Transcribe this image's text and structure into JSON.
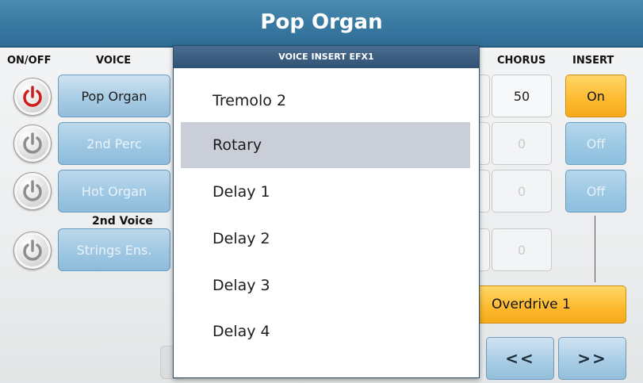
{
  "title": "Pop Organ",
  "headers": {
    "onoff": "ON/OFF",
    "voice": "VOICE",
    "chorus": "CHORUS",
    "insert": "INSERT"
  },
  "second_voice_label": "2nd Voice",
  "voices": [
    {
      "label": "Pop Organ",
      "power": "on"
    },
    {
      "label": "2nd Perc",
      "power": "off"
    },
    {
      "label": "Hot Organ",
      "power": "off"
    },
    {
      "label": "Strings Ens.",
      "power": "off"
    }
  ],
  "chorus_values": [
    "50",
    "0",
    "0",
    "0"
  ],
  "insert_buttons": [
    "On",
    "Off",
    "Off"
  ],
  "insert_effect": "Overdrive 1",
  "nav": {
    "prev": "<<",
    "next": ">>"
  },
  "popup": {
    "title": "VOICE INSERT EFX1",
    "items": [
      "Tremolo 2",
      "Rotary",
      "Delay 1",
      "Delay 2",
      "Delay 3",
      "Delay 4"
    ],
    "selected": "Rotary"
  },
  "colors": {
    "title_bar": "#3a7aa2",
    "accent_on": "#fdb92f",
    "voice_button": "#a9cde5",
    "power_on": "#d11a1a"
  }
}
